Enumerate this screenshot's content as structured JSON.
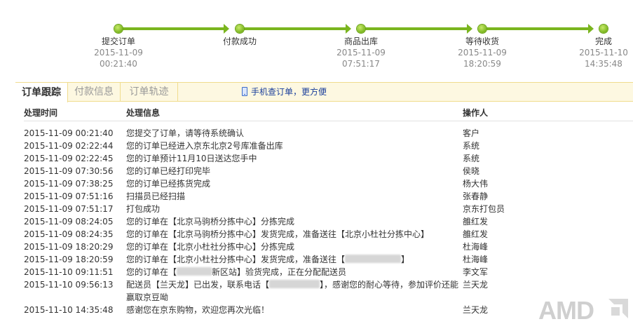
{
  "progress": {
    "steps": [
      {
        "name": "提交订单",
        "date": "2015-11-09",
        "time": "00:21:40"
      },
      {
        "name": "付款成功",
        "date": "",
        "time": ""
      },
      {
        "name": "商品出库",
        "date": "2015-11-09",
        "time": "07:51:17"
      },
      {
        "name": "等待收货",
        "date": "2015-11-09",
        "time": "18:20:59"
      },
      {
        "name": "完成",
        "date": "2015-11-10",
        "time": "14:35:48"
      }
    ],
    "color": "#7ab51e"
  },
  "tabs": [
    {
      "label": "订单跟踪",
      "active": true
    },
    {
      "label": "付款信息",
      "active": false
    },
    {
      "label": "订单轨迹",
      "active": false
    }
  ],
  "mobile_link": "手机查订单，更方便",
  "log": {
    "headers": {
      "time": "处理时间",
      "info": "处理信息",
      "operator": "操作人"
    },
    "rows": [
      {
        "time": "2015-11-09 00:21:40",
        "info": "您提交了订单，请等待系统确认",
        "operator": "客户"
      },
      {
        "time": "2015-11-09 02:22:44",
        "info": "您的订单已经进入京东北京2号库准备出库",
        "operator": "系统"
      },
      {
        "time": "2015-11-09 02:22:45",
        "info": "您的订单预计11月10日送达您手中",
        "operator": "系统"
      },
      {
        "time": "2015-11-09 07:30:56",
        "info": "您的订单已经打印完毕",
        "operator": "侯晓"
      },
      {
        "time": "2015-11-09 07:38:25",
        "info": "您的订单已经拣货完成",
        "operator": "杨大伟"
      },
      {
        "time": "2015-11-09 07:51:16",
        "info": "扫描员已经扫描",
        "operator": "张春静"
      },
      {
        "time": "2015-11-09 07:51:17",
        "info": "打包成功",
        "operator": "京东打包员"
      },
      {
        "time": "2015-11-09 08:24:05",
        "info": "您的订单在【北京马驹桥分拣中心】分拣完成",
        "operator": "雒红发"
      },
      {
        "time": "2015-11-09 08:24:35",
        "info": "您的订单在【北京马驹桥分拣中心】发货完成，准备送往【北京小杜社分拣中心】",
        "operator": "雒红发"
      },
      {
        "time": "2015-11-09 18:20:29",
        "info": "您的订单在【北京小杜社分拣中心】分拣完成",
        "operator": "杜海峰"
      },
      {
        "time": "2015-11-09 18:20:59",
        "info_pre": "您的订单在【北京小杜社分拣中心】发货完成，准备送往【",
        "info_post": "",
        "operator": "杜海峰"
      },
      {
        "time": "2015-11-10 09:11:51",
        "info_pre": "您的订单在【",
        "info_post": "新区站】验货完成，正在分配配送员",
        "operator": "李文军"
      },
      {
        "time": "2015-11-10 09:56:13",
        "info_pre": "配送员【兰天龙】已出发，联系电话【",
        "info_post": "】，感谢您的耐心等待，参加评价还能赢取京豆呦",
        "operator": "兰天龙"
      },
      {
        "time": "2015-11-10 14:35:48",
        "info": "感谢您在京东购物，欢迎您再次光临！",
        "operator": "兰天龙"
      }
    ]
  },
  "watermark": "AMD"
}
